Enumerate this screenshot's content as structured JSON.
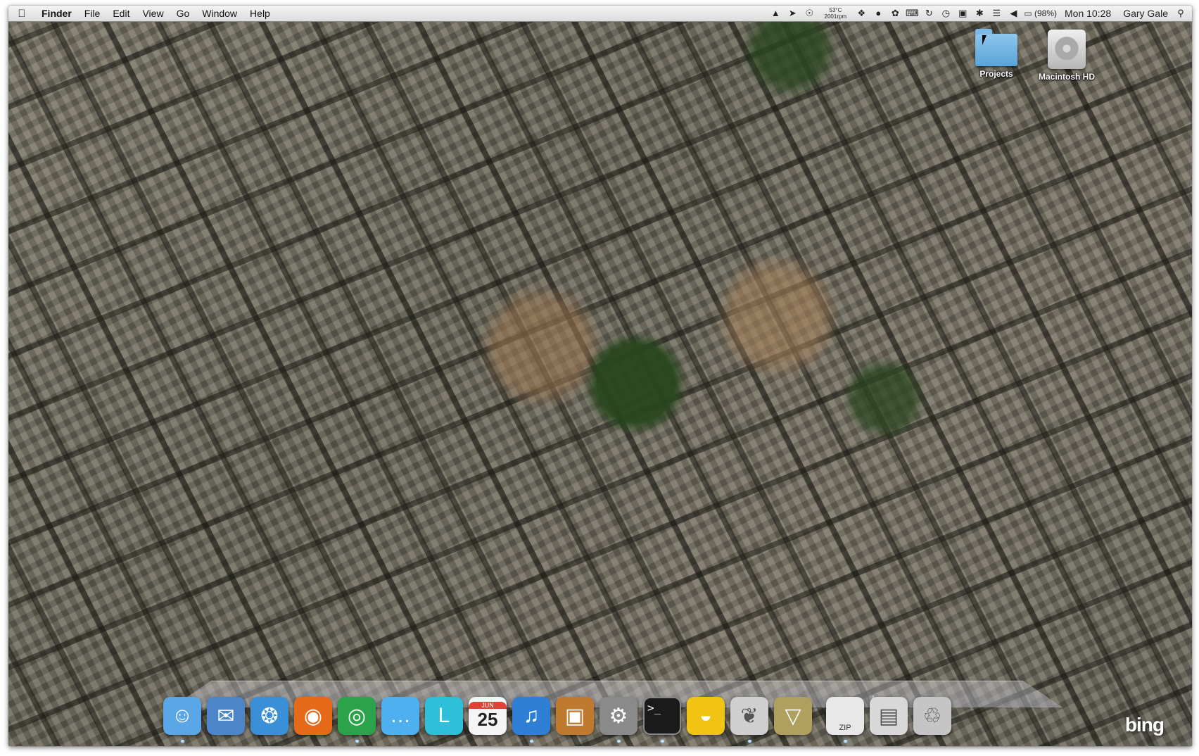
{
  "menubar": {
    "apple": "",
    "items": [
      "Finder",
      "File",
      "Edit",
      "View",
      "Go",
      "Window",
      "Help"
    ]
  },
  "status": {
    "temperature": "53°C",
    "fan": "2001rpm",
    "battery": "(98%)",
    "clock": "Mon 10:28",
    "user": "Gary Gale",
    "icons": [
      "growl-icon",
      "location-icon",
      "sensor-icon",
      "dropbox-icon",
      "hat-icon",
      "paw-icon",
      "keyboard-icon",
      "sync-icon",
      "time-machine-icon",
      "display-icon",
      "bluetooth-icon",
      "wifi-icon",
      "volume-icon",
      "battery-icon",
      "spotlight-icon"
    ]
  },
  "desktop": {
    "icons": [
      {
        "label": "Projects",
        "type": "folder"
      },
      {
        "label": "Macintosh HD",
        "type": "drive"
      }
    ]
  },
  "dock": {
    "apps": [
      {
        "name": "finder-icon",
        "color": "#5aa7e8"
      },
      {
        "name": "mail-icon",
        "color": "#4d86c8"
      },
      {
        "name": "safari-icon",
        "color": "#3b8fd6"
      },
      {
        "name": "firefox-icon",
        "color": "#e66a1a"
      },
      {
        "name": "chrome-icon",
        "color": "#2aa34a"
      },
      {
        "name": "ichat-icon",
        "color": "#4fb0ef"
      },
      {
        "name": "lightroom-icon",
        "color": "#2ec0d8"
      },
      {
        "name": "ical-icon",
        "color": "#f5f5f5"
      },
      {
        "name": "itunes-icon",
        "color": "#2e7fd5"
      },
      {
        "name": "iphoto-icon",
        "color": "#c07a30"
      },
      {
        "name": "system-preferences-icon",
        "color": "#8a8a8a"
      },
      {
        "name": "terminal-icon",
        "color": "#1a1a1a"
      },
      {
        "name": "cyberduck-icon",
        "color": "#f1c414"
      },
      {
        "name": "evernote-icon",
        "color": "#cfcfcf"
      },
      {
        "name": "filezilla-icon",
        "color": "#b0a060"
      },
      {
        "name": "archive-icon",
        "color": "#e8e8e8"
      },
      {
        "name": "preview-icon",
        "color": "#d8d8d8"
      },
      {
        "name": "trash-icon",
        "color": "#c5c5c5"
      }
    ],
    "calendar_month": "JUN",
    "calendar_day": "25",
    "archive_label": "ZIP",
    "terminal_prompt": ">_"
  },
  "wallpaper": {
    "watermark": "bing"
  }
}
